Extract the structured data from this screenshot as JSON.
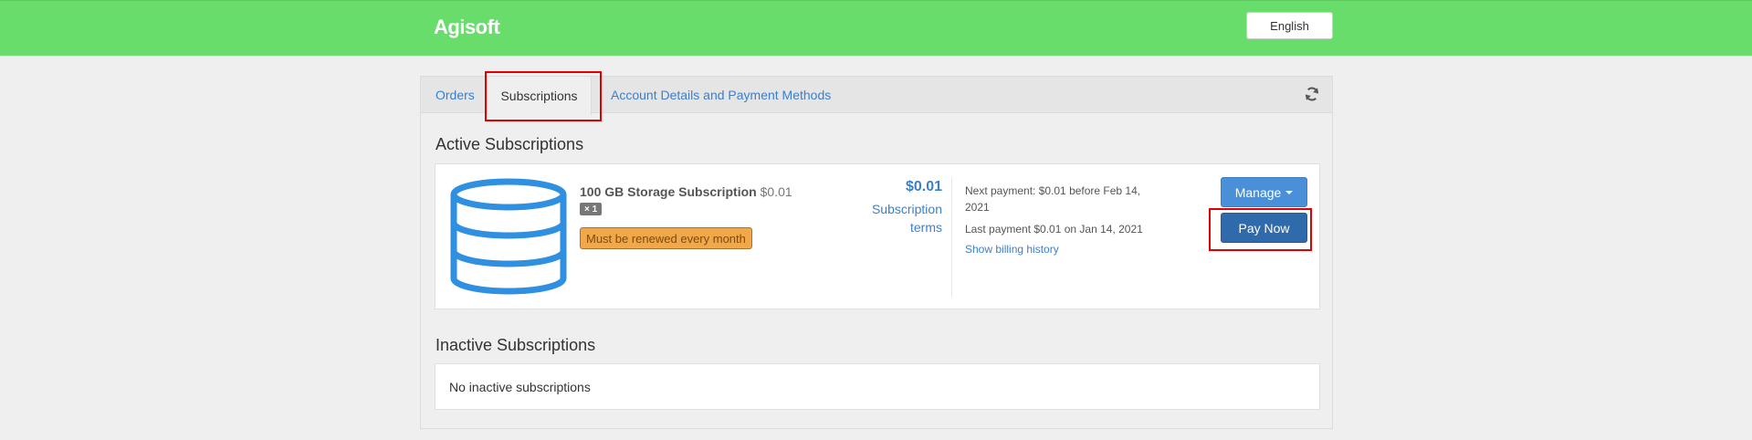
{
  "header": {
    "brand": "Agisoft",
    "language_button": "English"
  },
  "tabs": {
    "orders": "Orders",
    "subscriptions": "Subscriptions",
    "account": "Account Details and Payment Methods"
  },
  "icons": {
    "refresh": "refresh-icon",
    "product": "database-icon"
  },
  "colors": {
    "header_bg": "#68dd6b",
    "link": "#3b7fcc",
    "manage_button": "#4a90d9",
    "pay_button": "#2f6aaa",
    "renew_label": "#f0a84a",
    "highlight": "#e00000"
  },
  "active": {
    "title": "Active Subscriptions",
    "subscription": {
      "name": "100 GB Storage Subscription",
      "unit_price": "$0.01",
      "quantity": "× 1",
      "renewal_note": "Must be renewed every month",
      "price": "$0.01",
      "terms_link": "Subscription terms",
      "next_payment": "Next payment: $0.01 before Feb 14, 2021",
      "last_payment": "Last payment $0.01 on Jan 14, 2021",
      "billing_history_link": "Show billing history",
      "manage_button": "Manage",
      "pay_button": "Pay Now"
    }
  },
  "inactive": {
    "title": "Inactive Subscriptions",
    "empty_text": "No inactive subscriptions"
  }
}
